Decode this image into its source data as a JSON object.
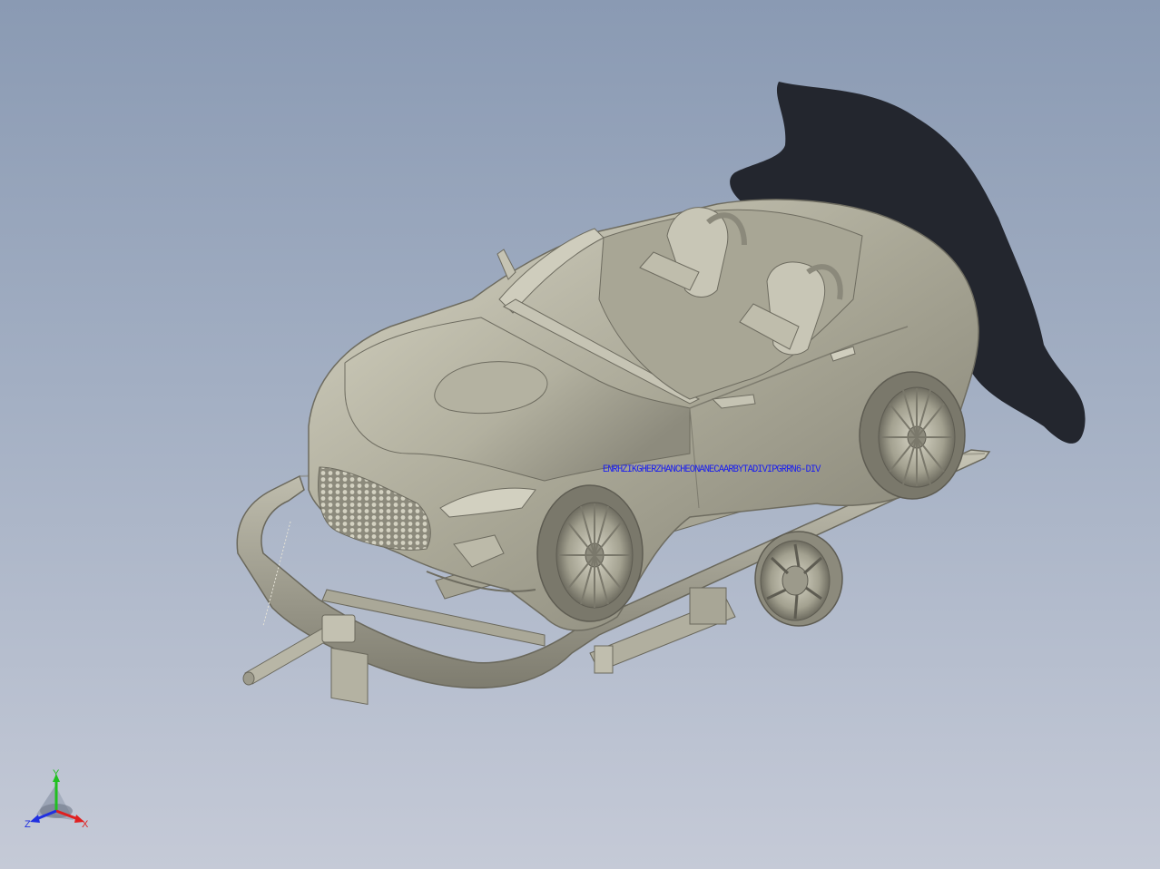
{
  "viewport": {
    "annotation_text": "ENRHZIKGHERZHANCHEONANECAARBYTADIVIPGRRN6-DIV",
    "background_top": "#8a9ab3",
    "background_bottom": "#c5cad7",
    "model_color": "#b9b7a6",
    "shadow_color": "#23262e"
  },
  "triad": {
    "x_label": "X",
    "y_label": "Y",
    "z_label": "Z",
    "x_color": "#e02020",
    "y_color": "#20c020",
    "z_color": "#2030e0"
  }
}
